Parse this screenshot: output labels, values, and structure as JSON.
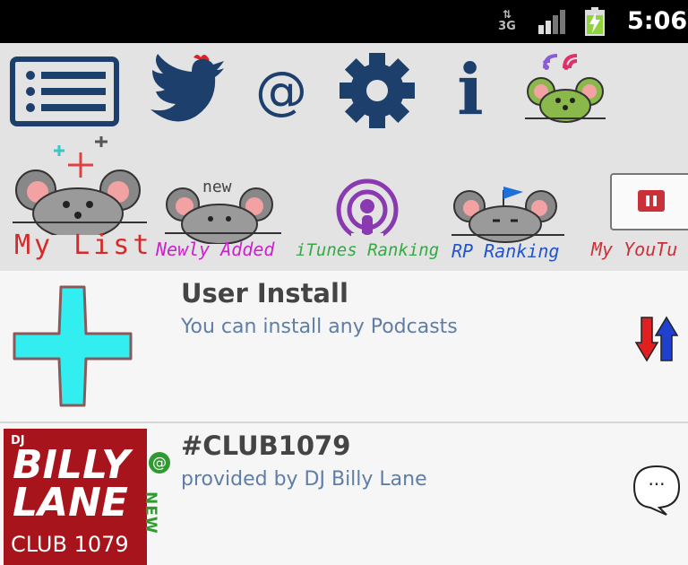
{
  "status_bar": {
    "network": "3G",
    "time": "5:06"
  },
  "toolbar": {
    "buttons": [
      {
        "icon": "list-icon"
      },
      {
        "icon": "twitter-bird-icon"
      },
      {
        "icon": "at-sign-icon",
        "glyph": "@"
      },
      {
        "icon": "gear-icon"
      },
      {
        "icon": "info-icon",
        "glyph": "i"
      },
      {
        "icon": "rss-mouse-icon"
      }
    ]
  },
  "categories": [
    {
      "label": "My List",
      "color": "#d42a2a"
    },
    {
      "label": "Newly Added",
      "color": "#cc22cc",
      "badge": "new"
    },
    {
      "label": "iTunes Ranking",
      "color": "#33aa44"
    },
    {
      "label": "RP Ranking",
      "color": "#2255cc"
    },
    {
      "label": "My YouTu",
      "color": "#c9303a"
    }
  ],
  "list": {
    "items": [
      {
        "title": "User Install",
        "subtitle": "You can install any Podcasts",
        "action_icon": "sort-arrows-icon"
      },
      {
        "title": "#CLUB1079",
        "subtitle": "provided by DJ Billy Lane",
        "thumb": {
          "dj": "DJ",
          "line1": "BILLY",
          "line2": "LANE",
          "line3": "CLUB 1079"
        },
        "new_badge": "NEW",
        "action_icon": "speech-bubble-icon",
        "action_glyph": "···"
      }
    ]
  },
  "colors": {
    "toolbar_icon": "#1c3f6b",
    "subtitle": "#5f7ea6",
    "title": "#444444",
    "plus": "#33eef0",
    "thumb_bg": "#a8141b",
    "new_badge": "#2f9a2f"
  }
}
